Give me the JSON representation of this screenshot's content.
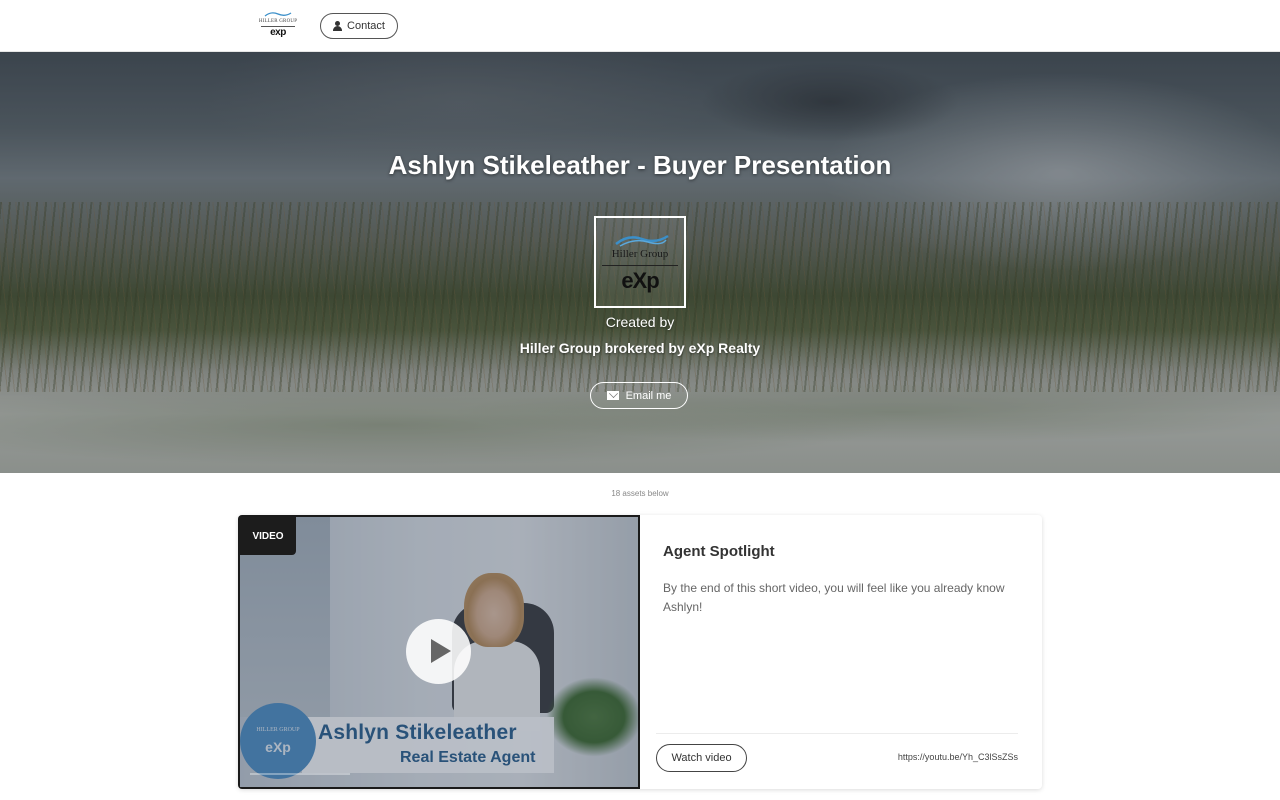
{
  "header": {
    "logo": {
      "brand": "HILLER GROUP",
      "exp": "exp"
    },
    "contact_label": "Contact"
  },
  "hero": {
    "title": "Ashlyn Stikeleather - Buyer Presentation",
    "logo": {
      "brand": "Hiller Group",
      "exp": "eXp"
    },
    "created_by": "Created by",
    "company": "Hiller Group brokered by eXp Realty",
    "email_label": "Email me"
  },
  "assets_count_text": "18 assets below",
  "card": {
    "tag": "VIDEO",
    "thumbnail": {
      "name": "Ashlyn Stikeleather",
      "role": "Real Estate Agent",
      "logo_brand": "HILLER GROUP",
      "logo_exp": "eXp"
    },
    "title": "Agent Spotlight",
    "description": "By the end of this short video, you will feel like you already know Ashlyn!",
    "watch_label": "Watch video",
    "link": "https://youtu.be/Yh_C3lSsZSs"
  },
  "colors": {
    "name_blue": "#2a5f8c",
    "logo_circle": "#4f8fc4",
    "tag_bg": "#1c1c1c"
  },
  "icons": {
    "contact": "person-icon",
    "email": "mail-icon",
    "play": "play-icon"
  }
}
